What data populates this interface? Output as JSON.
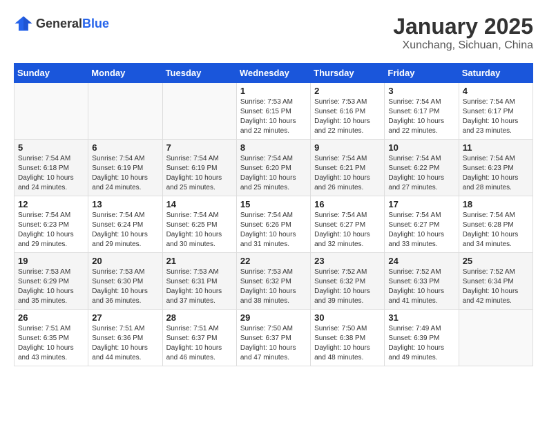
{
  "logo": {
    "general": "General",
    "blue": "Blue"
  },
  "title": "January 2025",
  "location": "Xunchang, Sichuan, China",
  "days_of_week": [
    "Sunday",
    "Monday",
    "Tuesday",
    "Wednesday",
    "Thursday",
    "Friday",
    "Saturday"
  ],
  "weeks": [
    {
      "days": [
        {
          "num": "",
          "info": ""
        },
        {
          "num": "",
          "info": ""
        },
        {
          "num": "",
          "info": ""
        },
        {
          "num": "1",
          "info": "Sunrise: 7:53 AM\nSunset: 6:15 PM\nDaylight: 10 hours\nand 22 minutes."
        },
        {
          "num": "2",
          "info": "Sunrise: 7:53 AM\nSunset: 6:16 PM\nDaylight: 10 hours\nand 22 minutes."
        },
        {
          "num": "3",
          "info": "Sunrise: 7:54 AM\nSunset: 6:17 PM\nDaylight: 10 hours\nand 22 minutes."
        },
        {
          "num": "4",
          "info": "Sunrise: 7:54 AM\nSunset: 6:17 PM\nDaylight: 10 hours\nand 23 minutes."
        }
      ]
    },
    {
      "days": [
        {
          "num": "5",
          "info": "Sunrise: 7:54 AM\nSunset: 6:18 PM\nDaylight: 10 hours\nand 24 minutes."
        },
        {
          "num": "6",
          "info": "Sunrise: 7:54 AM\nSunset: 6:19 PM\nDaylight: 10 hours\nand 24 minutes."
        },
        {
          "num": "7",
          "info": "Sunrise: 7:54 AM\nSunset: 6:19 PM\nDaylight: 10 hours\nand 25 minutes."
        },
        {
          "num": "8",
          "info": "Sunrise: 7:54 AM\nSunset: 6:20 PM\nDaylight: 10 hours\nand 25 minutes."
        },
        {
          "num": "9",
          "info": "Sunrise: 7:54 AM\nSunset: 6:21 PM\nDaylight: 10 hours\nand 26 minutes."
        },
        {
          "num": "10",
          "info": "Sunrise: 7:54 AM\nSunset: 6:22 PM\nDaylight: 10 hours\nand 27 minutes."
        },
        {
          "num": "11",
          "info": "Sunrise: 7:54 AM\nSunset: 6:23 PM\nDaylight: 10 hours\nand 28 minutes."
        }
      ]
    },
    {
      "days": [
        {
          "num": "12",
          "info": "Sunrise: 7:54 AM\nSunset: 6:23 PM\nDaylight: 10 hours\nand 29 minutes."
        },
        {
          "num": "13",
          "info": "Sunrise: 7:54 AM\nSunset: 6:24 PM\nDaylight: 10 hours\nand 29 minutes."
        },
        {
          "num": "14",
          "info": "Sunrise: 7:54 AM\nSunset: 6:25 PM\nDaylight: 10 hours\nand 30 minutes."
        },
        {
          "num": "15",
          "info": "Sunrise: 7:54 AM\nSunset: 6:26 PM\nDaylight: 10 hours\nand 31 minutes."
        },
        {
          "num": "16",
          "info": "Sunrise: 7:54 AM\nSunset: 6:27 PM\nDaylight: 10 hours\nand 32 minutes."
        },
        {
          "num": "17",
          "info": "Sunrise: 7:54 AM\nSunset: 6:27 PM\nDaylight: 10 hours\nand 33 minutes."
        },
        {
          "num": "18",
          "info": "Sunrise: 7:54 AM\nSunset: 6:28 PM\nDaylight: 10 hours\nand 34 minutes."
        }
      ]
    },
    {
      "days": [
        {
          "num": "19",
          "info": "Sunrise: 7:53 AM\nSunset: 6:29 PM\nDaylight: 10 hours\nand 35 minutes."
        },
        {
          "num": "20",
          "info": "Sunrise: 7:53 AM\nSunset: 6:30 PM\nDaylight: 10 hours\nand 36 minutes."
        },
        {
          "num": "21",
          "info": "Sunrise: 7:53 AM\nSunset: 6:31 PM\nDaylight: 10 hours\nand 37 minutes."
        },
        {
          "num": "22",
          "info": "Sunrise: 7:53 AM\nSunset: 6:32 PM\nDaylight: 10 hours\nand 38 minutes."
        },
        {
          "num": "23",
          "info": "Sunrise: 7:52 AM\nSunset: 6:32 PM\nDaylight: 10 hours\nand 39 minutes."
        },
        {
          "num": "24",
          "info": "Sunrise: 7:52 AM\nSunset: 6:33 PM\nDaylight: 10 hours\nand 41 minutes."
        },
        {
          "num": "25",
          "info": "Sunrise: 7:52 AM\nSunset: 6:34 PM\nDaylight: 10 hours\nand 42 minutes."
        }
      ]
    },
    {
      "days": [
        {
          "num": "26",
          "info": "Sunrise: 7:51 AM\nSunset: 6:35 PM\nDaylight: 10 hours\nand 43 minutes."
        },
        {
          "num": "27",
          "info": "Sunrise: 7:51 AM\nSunset: 6:36 PM\nDaylight: 10 hours\nand 44 minutes."
        },
        {
          "num": "28",
          "info": "Sunrise: 7:51 AM\nSunset: 6:37 PM\nDaylight: 10 hours\nand 46 minutes."
        },
        {
          "num": "29",
          "info": "Sunrise: 7:50 AM\nSunset: 6:37 PM\nDaylight: 10 hours\nand 47 minutes."
        },
        {
          "num": "30",
          "info": "Sunrise: 7:50 AM\nSunset: 6:38 PM\nDaylight: 10 hours\nand 48 minutes."
        },
        {
          "num": "31",
          "info": "Sunrise: 7:49 AM\nSunset: 6:39 PM\nDaylight: 10 hours\nand 49 minutes."
        },
        {
          "num": "",
          "info": ""
        }
      ]
    }
  ]
}
